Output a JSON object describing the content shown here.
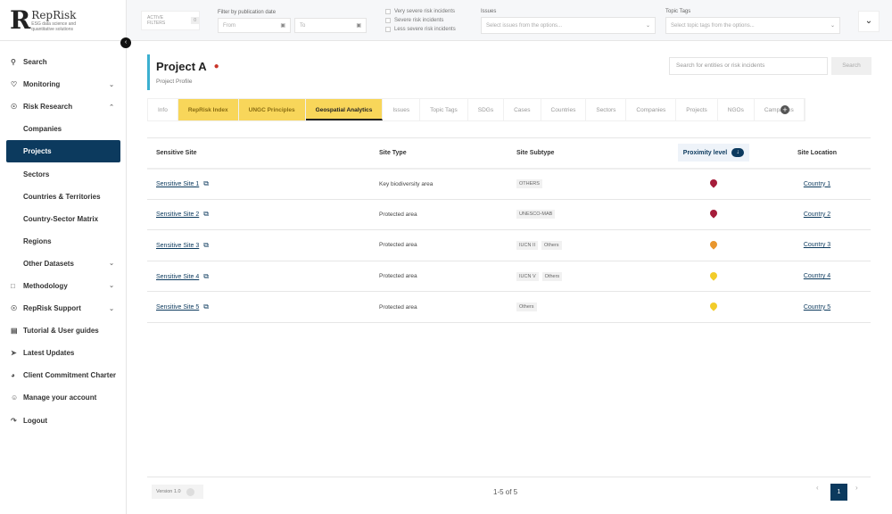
{
  "brand": {
    "name": "RepRisk",
    "tagline": "ESG data science and quantitative solutions"
  },
  "sidebar": {
    "items": [
      {
        "label": "Search",
        "icon": "search-icon",
        "level": 0
      },
      {
        "label": "Monitoring",
        "icon": "bell-icon",
        "level": 0,
        "expandable": "down"
      },
      {
        "label": "Risk Research",
        "icon": "globe-icon",
        "level": 0,
        "expandable": "up"
      },
      {
        "label": "Companies",
        "level": 1
      },
      {
        "label": "Projects",
        "level": 1,
        "active": true
      },
      {
        "label": "Sectors",
        "level": 1
      },
      {
        "label": "Countries & Territories",
        "level": 1
      },
      {
        "label": "Country-Sector Matrix",
        "level": 1
      },
      {
        "label": "Regions",
        "level": 1
      },
      {
        "label": "Other Datasets",
        "level": 1,
        "expandable": "down"
      },
      {
        "label": "Methodology",
        "icon": "book-icon",
        "level": 0,
        "expandable": "down"
      },
      {
        "label": "RepRisk Support",
        "icon": "headset-icon",
        "level": 0,
        "expandable": "down"
      },
      {
        "label": "Tutorial & User guides",
        "icon": "guide-icon",
        "level": 0
      },
      {
        "label": "Latest Updates",
        "icon": "rocket-icon",
        "level": 0
      },
      {
        "label": "Client Commitment Charter",
        "icon": "charter-icon",
        "level": 0
      },
      {
        "label": "Manage your account",
        "icon": "user-icon",
        "level": 0
      },
      {
        "label": "Logout",
        "icon": "logout-icon",
        "level": 0
      }
    ]
  },
  "filters": {
    "active_label": "ACTIVE FILTERS",
    "active_count": "0",
    "date_label": "Filter by publication date",
    "from_placeholder": "From",
    "to_placeholder": "To",
    "severity": [
      "Very severe risk incidents",
      "Severe risk incidents",
      "Less severe risk incidents"
    ],
    "issues_label": "Issues",
    "issues_placeholder": "Select issues from the options...",
    "tags_label": "Topic Tags",
    "tags_placeholder": "Select topic tags from the options..."
  },
  "header": {
    "title": "Project A",
    "subtitle": "Project Profile",
    "search_placeholder": "Search for entities or risk incidents",
    "search_button": "Search"
  },
  "tabs": [
    {
      "label": "Info"
    },
    {
      "label": "RepRisk Index",
      "highlight": true
    },
    {
      "label": "UNGC Principles",
      "highlight": true
    },
    {
      "label": "Geospatial Analytics",
      "selected": true
    },
    {
      "label": "Issues"
    },
    {
      "label": "Topic Tags"
    },
    {
      "label": "SDGs"
    },
    {
      "label": "Cases"
    },
    {
      "label": "Countries"
    },
    {
      "label": "Sectors"
    },
    {
      "label": "Companies"
    },
    {
      "label": "Projects"
    },
    {
      "label": "NGOs"
    },
    {
      "label": "Campaigns"
    }
  ],
  "table": {
    "columns": [
      "Sensitive Site",
      "Site Type",
      "Site Subtype",
      "Proximity level",
      "Site Location"
    ],
    "rows": [
      {
        "site": "Sensitive Site 1",
        "type": "Key biodiversity area",
        "subtypes": [
          "OTHERS"
        ],
        "proximity_color": "#a51c3a",
        "location": "Country 1"
      },
      {
        "site": "Sensitive Site 2",
        "type": "Protected area",
        "subtypes": [
          "UNESCO-MAB"
        ],
        "proximity_color": "#a51c3a",
        "location": "Country 2"
      },
      {
        "site": "Sensitive Site 3",
        "type": "Protected area",
        "subtypes": [
          "IUCN II",
          "Others"
        ],
        "proximity_color": "#e8962e",
        "location": "Country 3"
      },
      {
        "site": "Sensitive Site 4",
        "type": "Protected area",
        "subtypes": [
          "IUCN V",
          "Others"
        ],
        "proximity_color": "#f2cc2a",
        "location": "Country 4"
      },
      {
        "site": "Sensitive Site 5",
        "type": "Protected area",
        "subtypes": [
          "Others"
        ],
        "proximity_color": "#f2cc2a",
        "location": "Country 5"
      }
    ]
  },
  "footer": {
    "version": "Version 1.0",
    "count": "1-5 of 5",
    "page": "1"
  }
}
